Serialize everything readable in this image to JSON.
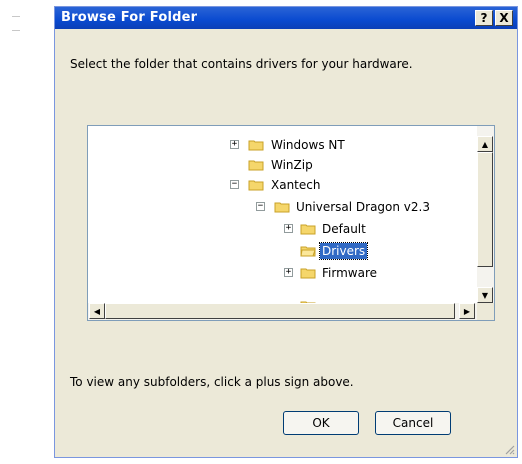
{
  "window": {
    "title": "Browse For Folder",
    "help_label": "?",
    "close_label": "X"
  },
  "instruction": "Select the folder that contains drivers for your hardware.",
  "tree": {
    "nodes": [
      {
        "label": "Windows NT",
        "expander": "+",
        "selected": false
      },
      {
        "label": "WinZip",
        "expander": "",
        "selected": false
      },
      {
        "label": "Xantech",
        "expander": "−",
        "selected": false
      },
      {
        "label": "Universal Dragon v2.3",
        "expander": "−",
        "selected": false
      },
      {
        "label": "Default",
        "expander": "+",
        "selected": false
      },
      {
        "label": "Drivers",
        "expander": "",
        "selected": true
      },
      {
        "label": "Firmware",
        "expander": "+",
        "selected": false
      }
    ],
    "scroll_up": "▲",
    "scroll_down": "▼",
    "scroll_left": "◀",
    "scroll_right": "▶"
  },
  "hint": "To view any subfolders, click a plus sign above.",
  "buttons": {
    "ok": "OK",
    "cancel": "Cancel"
  },
  "colors": {
    "title_bar": "#0a4ad0",
    "selection": "#316ac5",
    "folder": "#f5d66b"
  }
}
